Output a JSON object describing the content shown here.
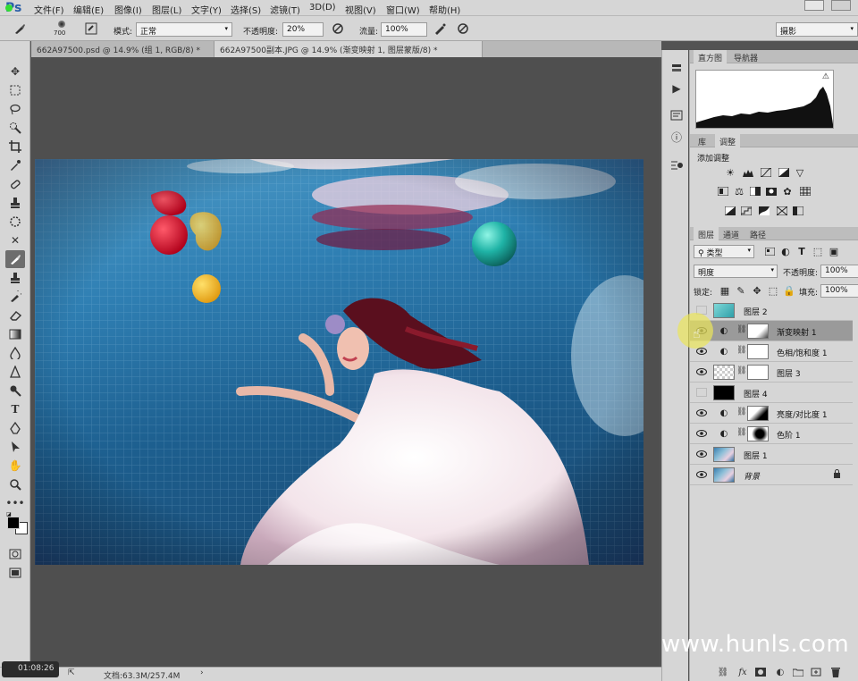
{
  "app": {
    "logo": "Ps"
  },
  "menu": [
    "文件(F)",
    "编辑(E)",
    "图像(I)",
    "图层(L)",
    "文字(Y)",
    "选择(S)",
    "滤镜(T)",
    "3D(D)",
    "视图(V)",
    "窗口(W)",
    "帮助(H)"
  ],
  "options": {
    "brush_size": "700",
    "mode_label": "模式:",
    "mode_value": "正常",
    "opacity_label": "不透明度:",
    "opacity_value": "20%",
    "flow_label": "流量:",
    "flow_value": "100%",
    "workspace": "摄影"
  },
  "tabs": [
    {
      "label": "662A97500.psd @ 14.9% (组 1, RGB/8) *",
      "active": false
    },
    {
      "label": "662A97500副本.JPG @ 14.9% (渐变映射 1, 图层蒙版/8) *",
      "active": true
    }
  ],
  "status": {
    "timer": "01:08:26",
    "doc_size": "文档:63.3M/257.4M"
  },
  "panels": {
    "top_tabs": [
      "直方图",
      "导航器"
    ],
    "mid_tabs": [
      "库",
      "调整"
    ],
    "adjust_title": "添加调整",
    "layer_tabs": [
      "图层",
      "通道",
      "路径"
    ],
    "kind_filter": "类型",
    "blend_mode": "明度",
    "opacity_label": "不透明度:",
    "opacity_value": "100%",
    "lock_label": "锁定:",
    "fill_label": "填充:",
    "fill_value": "100%"
  },
  "layers": [
    {
      "name": "图层 2",
      "visible": false,
      "thumb": "teal",
      "adjustment": false,
      "mask": false,
      "selected": false
    },
    {
      "name": "渐变映射 1",
      "visible": true,
      "thumb": "",
      "adjustment": true,
      "mask": true,
      "selected": true
    },
    {
      "name": "色相/饱和度 1",
      "visible": true,
      "thumb": "",
      "adjustment": true,
      "mask": true,
      "selected": false
    },
    {
      "name": "图层 3",
      "visible": true,
      "thumb": "checker",
      "adjustment": false,
      "mask": true,
      "selected": false
    },
    {
      "name": "图层 4",
      "visible": false,
      "thumb": "black",
      "adjustment": false,
      "mask": false,
      "selected": false
    },
    {
      "name": "亮度/对比度 1",
      "visible": true,
      "thumb": "",
      "adjustment": true,
      "mask": true,
      "selected": false
    },
    {
      "name": "色阶 1",
      "visible": true,
      "thumb": "",
      "adjustment": true,
      "mask": true,
      "selected": false
    },
    {
      "name": "图层 1",
      "visible": true,
      "thumb": "photo",
      "adjustment": false,
      "mask": false,
      "selected": false
    },
    {
      "name": "背景",
      "visible": true,
      "thumb": "photo",
      "adjustment": false,
      "mask": false,
      "selected": false,
      "locked": true
    }
  ],
  "watermark": "www.hunls.com",
  "colors": {
    "accent": "#2a5fa8",
    "panel_bg": "#d6d6d6",
    "canvas_bg": "#4f4f4f",
    "selected_row": "#9a9a9a"
  }
}
